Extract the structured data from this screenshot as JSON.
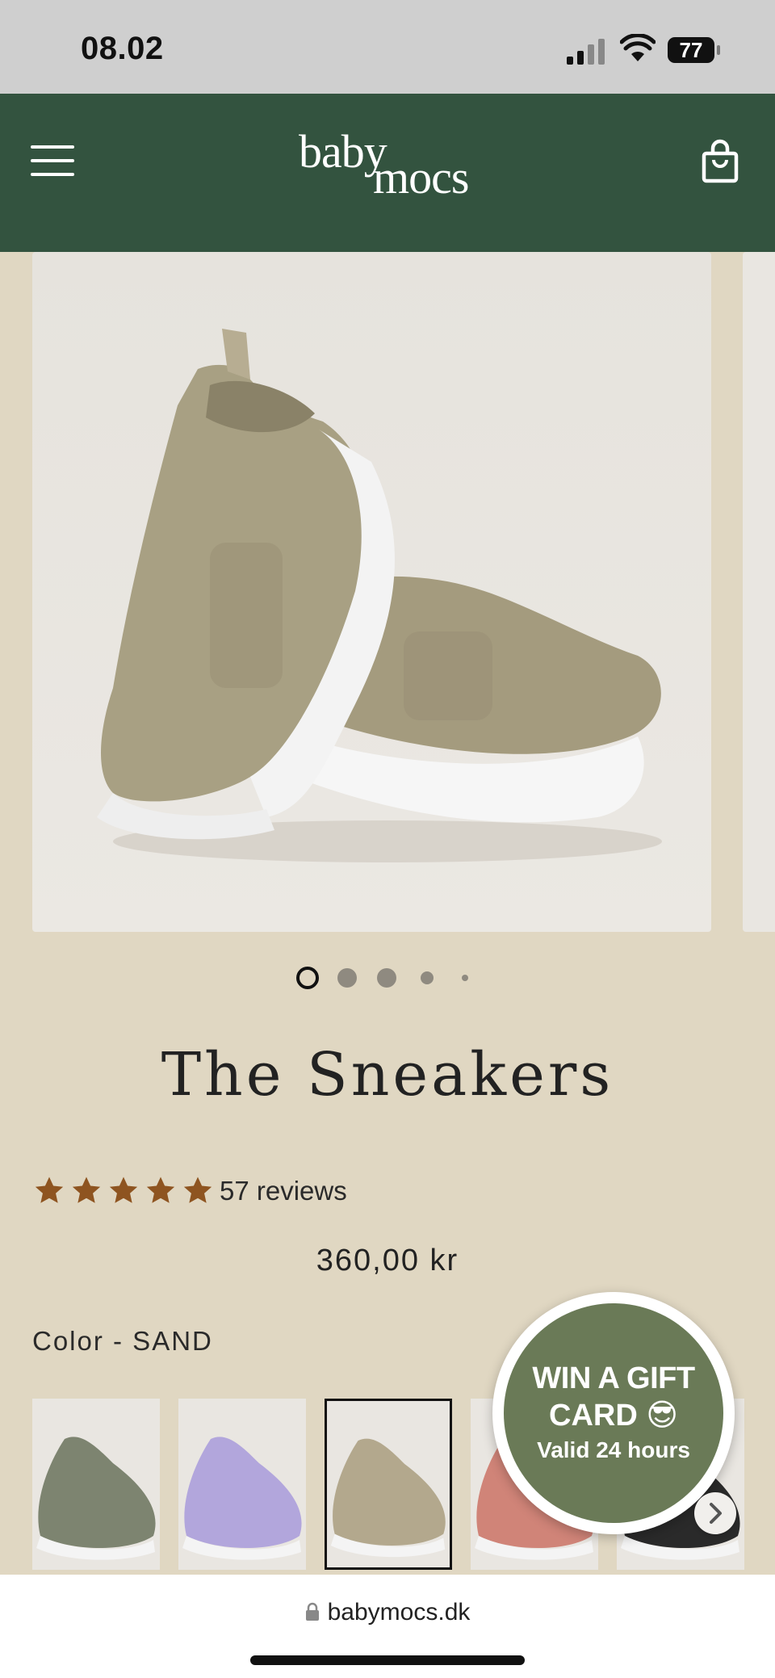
{
  "status_bar": {
    "time": "08.02",
    "battery": "77"
  },
  "header": {
    "logo_line1": "baby",
    "logo_line2": "mocs"
  },
  "gallery": {
    "slide_count": 5,
    "active_slide": 1
  },
  "product": {
    "title": "The Sneakers",
    "rating": 5,
    "reviews": "57 reviews",
    "price": "360,00 kr",
    "color_label": "Color - SAND"
  },
  "swatches": [
    {
      "name": "olive",
      "color": "#7d8470"
    },
    {
      "name": "lavender",
      "color": "#b2a6dc"
    },
    {
      "name": "sand",
      "color": "#b3a88d",
      "selected": true
    },
    {
      "name": "rose",
      "color": "#d08478"
    },
    {
      "name": "black",
      "color": "#2a2a2a"
    }
  ],
  "gift_badge": {
    "line1": "WIN A GIFT",
    "line2": "CARD 😎",
    "line3": "Valid 24 hours"
  },
  "browser": {
    "url": "babymocs.dk"
  }
}
